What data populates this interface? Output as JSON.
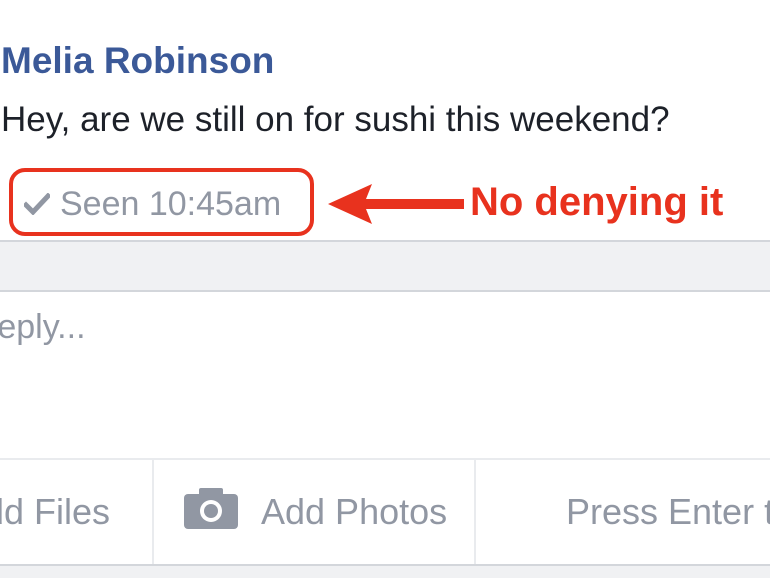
{
  "message": {
    "sender": "Melia Robinson",
    "text": "Hey, are we still on for sushi this weekend?",
    "seen_label": "Seen 10:45am",
    "seen_icon": "checkmark-icon"
  },
  "annotation": {
    "label": "No denying it",
    "color": "#e8321e"
  },
  "composer": {
    "placeholder": "reply...",
    "toolbar": {
      "add_files": "dd Files",
      "add_photos": "Add Photos",
      "press_enter": "Press Enter t",
      "camera_icon": "camera-icon"
    }
  },
  "colors": {
    "sender_name": "#3b5998",
    "muted_text": "#9197a3",
    "message_text": "#1d2129"
  }
}
